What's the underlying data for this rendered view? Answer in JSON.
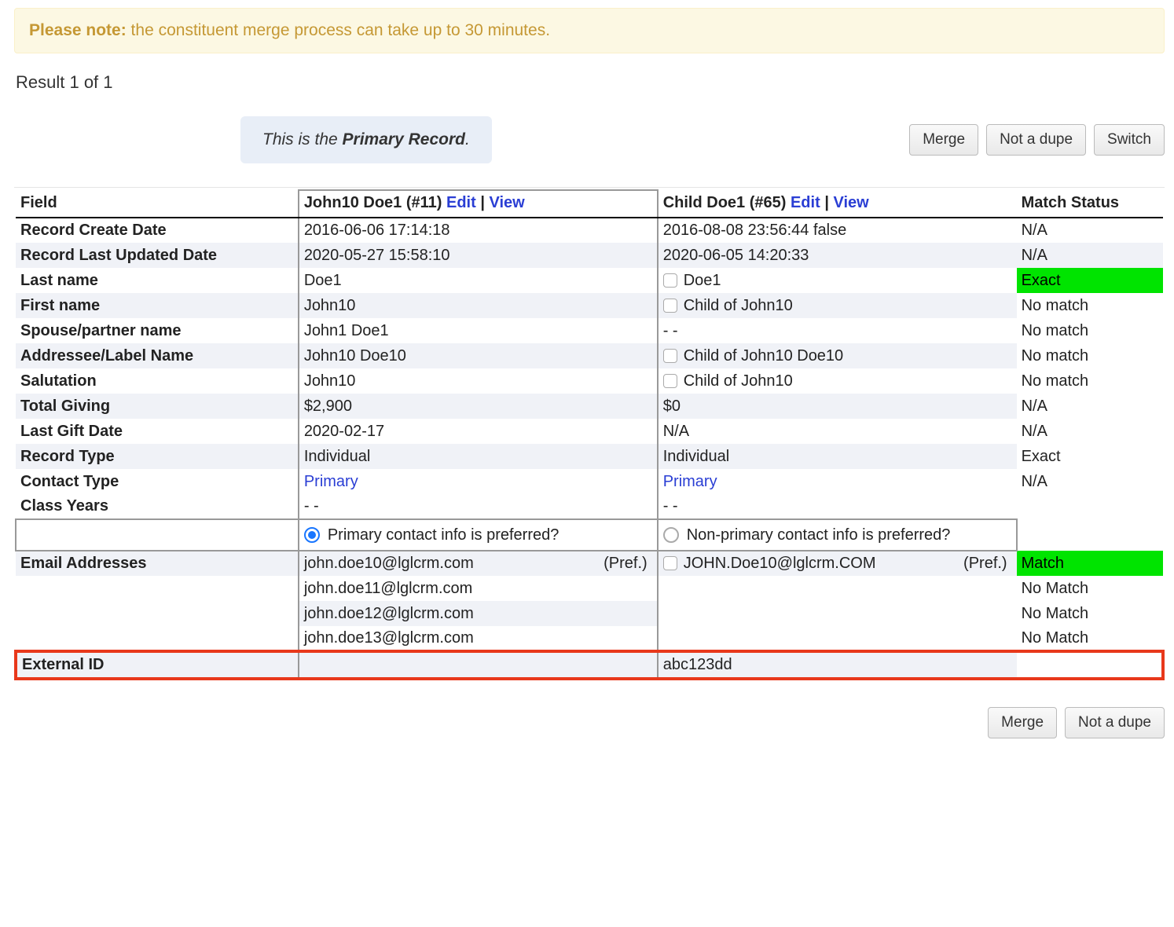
{
  "note": {
    "label": "Please note:",
    "text": " the constituent merge process can take up to 30 minutes."
  },
  "result_count": "Result 1 of 1",
  "primary_badge": {
    "prefix": "This is the ",
    "bold": "Primary Record",
    "suffix": "."
  },
  "buttons": {
    "merge": "Merge",
    "not_dupe": "Not a dupe",
    "switch": "Switch"
  },
  "headers": {
    "field": "Field",
    "match_status": "Match Status",
    "rec1": {
      "name": "John10 Doe1 (#11)",
      "edit": "Edit",
      "view": "View"
    },
    "rec2": {
      "name": "Child Doe1 (#65)",
      "edit": "Edit",
      "view": "View"
    }
  },
  "rows": {
    "create_date": {
      "label": "Record Create Date",
      "v1": "2016-06-06 17:14:18",
      "v2": "2016-08-08 23:56:44 false",
      "status": "N/A"
    },
    "updated_date": {
      "label": "Record Last Updated Date",
      "v1": "2020-05-27 15:58:10",
      "v2": "2020-06-05 14:20:33",
      "status": "N/A"
    },
    "last_name": {
      "label": "Last name",
      "v1": "Doe1",
      "v2": "Doe1",
      "status": "Exact"
    },
    "first_name": {
      "label": "First name",
      "v1": "John10",
      "v2": "Child of John10",
      "status": "No match"
    },
    "spouse": {
      "label": "Spouse/partner name",
      "v1": "John1 Doe1",
      "v2": "   - -",
      "status": "No match"
    },
    "addressee": {
      "label": "Addressee/Label Name",
      "v1": "John10 Doe10",
      "v2": "Child of John10 Doe10",
      "status": "No match"
    },
    "salutation": {
      "label": "Salutation",
      "v1": "John10",
      "v2": "Child of John10",
      "status": "No match"
    },
    "total_giving": {
      "label": "Total Giving",
      "v1": "$2,900",
      "v2": "$0",
      "status": "N/A"
    },
    "last_gift": {
      "label": "Last Gift Date",
      "v1": "2020-02-17",
      "v2": "N/A",
      "status": "N/A"
    },
    "record_type": {
      "label": "Record Type",
      "v1": "Individual",
      "v2": "Individual",
      "status": "Exact"
    },
    "contact_type": {
      "label": "Contact Type",
      "v1": "Primary",
      "v2": "Primary",
      "status": "N/A"
    },
    "class_years": {
      "label": "Class Years",
      "v1": "- -",
      "v2": "- -",
      "status": ""
    },
    "pref_radio": {
      "v1": "Primary contact info is preferred?",
      "v2": "Non-primary contact info is preferred?"
    },
    "emails": {
      "label": "Email Addresses",
      "v1_main": "john.doe10@lglcrm.com",
      "v1_tag": "(Pref.)",
      "v2_main": "JOHN.Doe10@lglcrm.COM",
      "v2_tag": "(Pref.)",
      "status": "Match",
      "extra1": "john.doe11@lglcrm.com",
      "extra1_status": "No Match",
      "extra2": "john.doe12@lglcrm.com",
      "extra2_status": "No Match",
      "extra3": "john.doe13@lglcrm.com",
      "extra3_status": "No Match"
    },
    "external_id": {
      "label": "External ID",
      "v1": "",
      "v2": "abc123dd",
      "status": ""
    }
  }
}
